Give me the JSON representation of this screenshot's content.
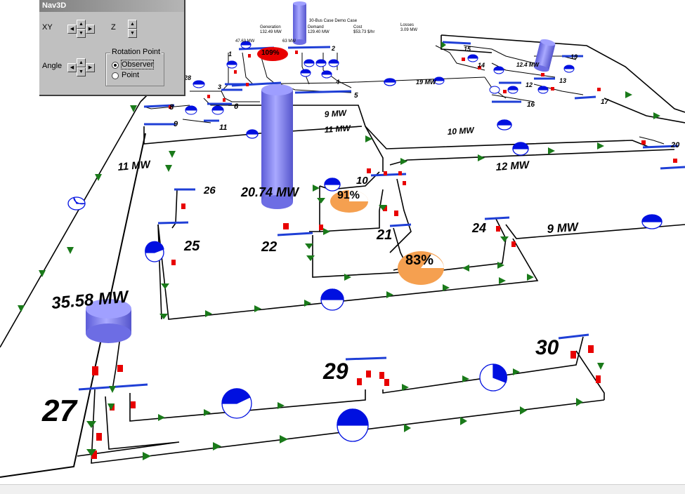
{
  "window": {
    "title": "Nav3D"
  },
  "nav3d": {
    "xy_label": "XY",
    "z_label": "Z",
    "angle_label": "Angle",
    "rotation_group_label": "Rotation Point",
    "rotation_options": [
      "Observer",
      "Point"
    ],
    "rotation_selected": "Observer"
  },
  "summary": {
    "generation_label": "Generation",
    "generation_value": "132.49 MW",
    "demand_label": "Demand",
    "demand_value": "129.40 MW",
    "cost_label": "Cost",
    "cost_value": "$53.73 $/hr",
    "losses_label": "Losses",
    "losses_value": "3.09 MW",
    "case_title": "30-Bus Case Demo Case"
  },
  "buses": {
    "b1": "1",
    "b2": "2",
    "b3": "3",
    "b4": "4",
    "b5": "5",
    "b6": "6",
    "b8": "8",
    "b9": "9",
    "b10": "10",
    "b11": "11",
    "b12": "12",
    "b13": "13",
    "b14": "14",
    "b15": "15",
    "b16": "16",
    "b17": "17",
    "b19": "19",
    "b20": "20",
    "b21": "21",
    "b22": "22",
    "b24": "24",
    "b25": "25",
    "b26": "26",
    "b27": "27",
    "b28": "28",
    "b29": "29",
    "b30": "30"
  },
  "flows": {
    "f_19mw": "19 MW",
    "f_9mw_top": "9 MW",
    "f_11mw_top": "11 MW",
    "f_10mw": "10 MW",
    "f_12mw": "12 MW",
    "f_11mw_left": "11 MW",
    "f_9mw_right": "9 MW",
    "f_12_4mw": "12.4 MW",
    "f_47mw": "47.63 MW",
    "f_63mw": "63 MW"
  },
  "generators": {
    "gen22_label": "20.74 MW",
    "gen27_label": "35.58 MW"
  },
  "line_loadings": {
    "pie_91": "91%",
    "pie_83": "83%",
    "pie_top": "109%"
  },
  "colors": {
    "bus": "#1f3fd6",
    "line": "#000000",
    "arrow": "#1a7a1a",
    "breaker": "#e80000",
    "cylinder": "#7f7ff5",
    "pie_orange": "#f5a050",
    "gauge_blue": "#0010e0",
    "window_bg": "#c0c0c0"
  }
}
